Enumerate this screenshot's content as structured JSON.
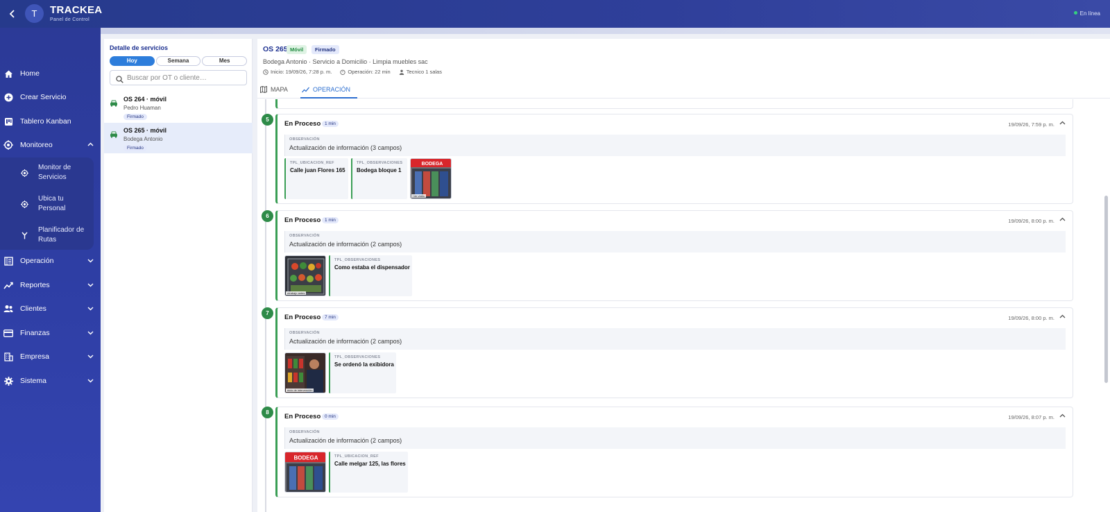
{
  "header": {
    "avatar_letter": "T",
    "brand": "TRACKEA",
    "brand_sub": "Panel de Control",
    "status": "En línea"
  },
  "sidebar": {
    "items": [
      {
        "label": "Home",
        "icon": "home-icon"
      },
      {
        "label": "Crear Servicio",
        "icon": "plus-circle-icon"
      },
      {
        "label": "Tablero Kanban",
        "icon": "kanban-icon"
      },
      {
        "label": "Monitoreo",
        "icon": "target-icon"
      },
      {
        "label": "Operación",
        "icon": "ledger-icon"
      },
      {
        "label": "Reportes",
        "icon": "trend-icon"
      },
      {
        "label": "Clientes",
        "icon": "people-icon"
      },
      {
        "label": "Finanzas",
        "icon": "card-icon"
      },
      {
        "label": "Empresa",
        "icon": "building-icon"
      },
      {
        "label": "Sistema",
        "icon": "gear-icon"
      }
    ],
    "monitoreo_sub": [
      {
        "label": "Monitor de Servicios"
      },
      {
        "label": "Ubica tu Personal"
      },
      {
        "label": "Planificador de Rutas"
      }
    ]
  },
  "list": {
    "title": "Detalle de servicios",
    "filters": [
      "Hoy",
      "Semana",
      "Mes"
    ],
    "active_filter": "Hoy",
    "search_placeholder": "Buscar por OT o cliente…",
    "services": [
      {
        "name": "OS 264 · móvil",
        "client": "Pedro Huaman",
        "status": "Firmado"
      },
      {
        "name": "OS 265 · móvil",
        "client": "Bodega Antonio",
        "status": "Firmado"
      }
    ]
  },
  "detail": {
    "title": "OS 265",
    "tag_type": "Móvil",
    "tag_status": "Firmado",
    "subtitle": "Bodega Antonio · Servicio a Domicilio · Limpia muebles sac",
    "inicio": "Inicio: 19/09/26, 7:28 p. m.",
    "operacion": "Operación: 22 min",
    "tecnico": "Tecnico 1 salas",
    "tabs": [
      "MAPA",
      "OPERACIÓN"
    ],
    "active_tab": "OPERACIÓN"
  },
  "steps": [
    {
      "num": "5",
      "title": "En Proceso",
      "duration": "1 min",
      "time": "19/09/26, 7:59 p. m.",
      "obs_label": "OBSERVACIÓN",
      "obs_text": "Actualización de información (3 campos)",
      "fields": [
        {
          "label": "TPL_UBICACION_REF",
          "value": "Calle juan Flores 165"
        },
        {
          "label": "TPL_OBSERVACIONES",
          "value": "Bodega bloque 1"
        }
      ],
      "photo_caption": "i de visita"
    },
    {
      "num": "6",
      "title": "En Proceso",
      "duration": "1 min",
      "time": "19/09/26, 8:00 p. m.",
      "obs_label": "OBSERVACIÓN",
      "obs_text": "Actualización de información (2 campos)",
      "fields": [
        {
          "label": "TPL_OBSERVACIONES",
          "value": "Como estaba el dispensador"
        }
      ],
      "photo_caption": "ntrabajo antes"
    },
    {
      "num": "7",
      "title": "En Proceso",
      "duration": "7 min",
      "time": "19/09/26, 8:00 p. m.",
      "obs_label": "OBSERVACIÓN",
      "obs_text": "Actualización de información (2 campos)",
      "fields": [
        {
          "label": "TPL_OBSERVACIONES",
          "value": "Se ordenó la exibidora"
        }
      ],
      "photo_caption": "nicio de intervención"
    },
    {
      "num": "8",
      "title": "En Proceso",
      "duration": "0 min",
      "time": "19/09/26, 8:07 p. m.",
      "obs_label": "OBSERVACIÓN",
      "obs_text": "Actualización de información (2 campos)",
      "fields": [
        {
          "label": "TPL_UBICACION_REF",
          "value": "Calle melgar 125, las flores"
        }
      ],
      "photo_caption": ""
    }
  ],
  "photo_sign_text": "BODEGA",
  "colors": {
    "primary": "#2c3a97",
    "accent": "#2d7ddb",
    "success": "#3a9e55"
  }
}
